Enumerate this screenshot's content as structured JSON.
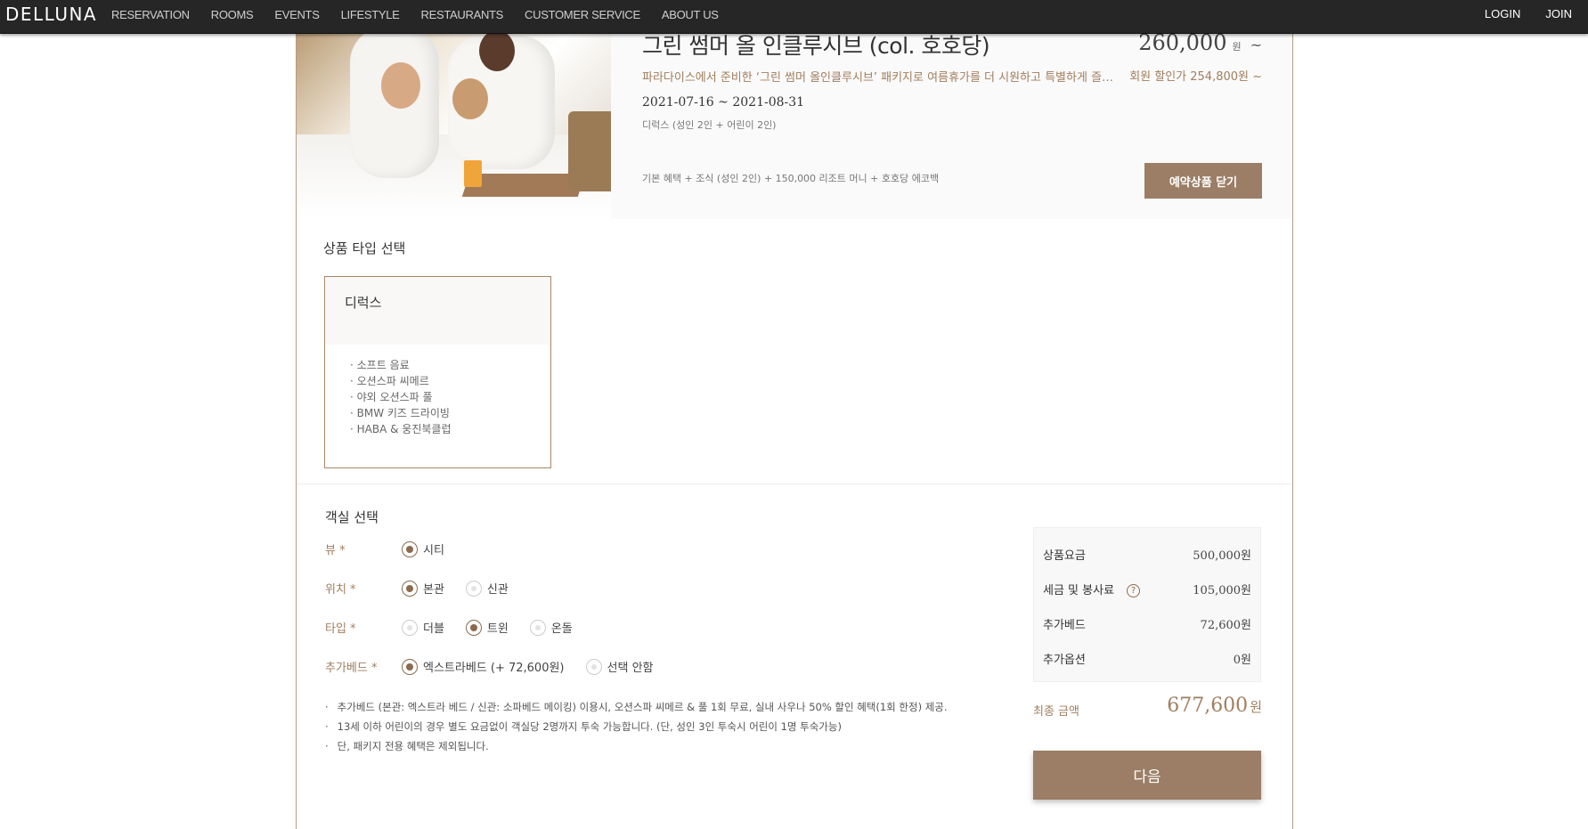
{
  "brand": {
    "logo": "DELLUNA"
  },
  "nav": {
    "items": [
      "RESERVATION",
      "ROOMS",
      "EVENTS",
      "LIFESTYLE",
      "RESTAURANTS",
      "CUSTOMER SERVICE",
      "ABOUT US"
    ],
    "login": "LOGIN",
    "join": "JOIN"
  },
  "package": {
    "title": "그린 썸머 올 인클루시브 (col. 호호당)",
    "description": "파라다이스에서 준비한 ‘그린 썸머 올인클루시브’ 패키지로 여름휴가를 더 시원하고 특별하게 즐겨보세요",
    "dates": "2021-07-16 ~ 2021-08-31",
    "occupancy": "디럭스 (성인 2인 + 어린이 2인)",
    "benefits": "기본 혜택 + 조식 (성인 2인) + 150,000 리조트 머니 + 호호당 에코백",
    "price": "260,000",
    "price_unit": "원",
    "price_suffix": "~",
    "member_price": "회원 할인가 254,800원 ~",
    "close_button": "예약상품 닫기"
  },
  "product_type": {
    "section_title": "상품 타입 선택",
    "card_title": "디럭스",
    "features": [
      "· 소프트 음료",
      "· 오션스파 씨메르",
      "· 야외 오션스파 풀",
      "· BMW 키즈 드라이빙",
      "· HABA & 웅진북클럽"
    ]
  },
  "room": {
    "section_title": "객실 선택",
    "view": {
      "label": "뷰 *",
      "options": [
        "시티"
      ],
      "selected": 0
    },
    "location": {
      "label": "위치 *",
      "options": [
        "본관",
        "신관"
      ],
      "selected": 0
    },
    "type": {
      "label": "타입 *",
      "options": [
        "더블",
        "트윈",
        "온돌"
      ],
      "selected": 1
    },
    "extra_bed": {
      "label": "추가베드 *",
      "options": [
        "엑스트라베드 (+ 72,600원)",
        "선택 안함"
      ],
      "selected": 0
    },
    "notes": [
      "추가베드 (본관: 엑스트라 베드 / 신관: 소파베드 메이킹) 이용시, 오션스파 씨메르 & 풀 1회 무료, 실내 사우나 50% 할인 혜택(1회 한정) 제공.",
      "13세 이하 어린이의 경우 별도 요금없이 객실당 2명까지 투숙 가능합니다. (단, 성인 3인 투숙시 어린이 1명 투숙가능)",
      "단, 패키지 전용 혜택은 제외됩니다."
    ]
  },
  "summary": {
    "rows": [
      {
        "label": "상품요금",
        "value": "500,000원"
      },
      {
        "label": "세금 및 봉사료",
        "value": "105,000원"
      },
      {
        "label": "추가베드",
        "value": "72,600원"
      },
      {
        "label": "추가옵션",
        "value": "0원"
      }
    ],
    "help_glyph": "?",
    "final_label": "최종 금액",
    "final_amount": "677,600",
    "final_unit": "원",
    "next_button": "다음"
  },
  "colors": {
    "accent": "#9b7e65",
    "accent_text": "#a07e5e",
    "topbar": "#262626"
  }
}
